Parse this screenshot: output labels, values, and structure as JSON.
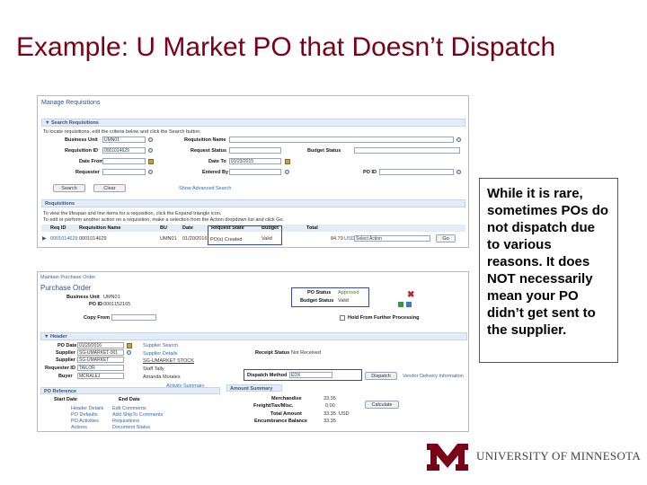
{
  "slide": {
    "title": "Example: U Market PO that Doesn’t Dispatch",
    "callout": "While it is rare, sometimes POs do not dispatch due to various reasons. It does NOT necessarily mean your PO didn’t get sent to the supplier.",
    "footer_org": "UNIVERSITY OF MINNESOTA",
    "colors": {
      "title": "#7a0019",
      "footer_logo": "#7a0019"
    }
  },
  "manage_requisitions": {
    "heading": "Manage Requisitions",
    "search_section": "Search Requisitions",
    "instructions": "To locate requisitions, edit the criteria below and click the Search button.",
    "fields": {
      "business_unit_label": "Business Unit",
      "business_unit_value": "UMN01",
      "requisition_id_label": "Requisition ID",
      "requisition_id_value": "0001014629",
      "date_from_label": "Date From",
      "requester_label": "Requester",
      "requisition_name_label": "Requisition Name",
      "request_status_label": "Request Status",
      "date_to_label": "Date To",
      "date_to_value": "01/23/2015",
      "entered_by_label": "Entered By",
      "budget_status_label": "Budget Status",
      "po_id_label": "PO ID"
    },
    "search_button": "Search",
    "clear_button": "Clear",
    "advanced_link": "Show Advanced Search",
    "results_section": "Requisitions",
    "results_note": "To view the lifespan and line items for a requisition, click the Expand triangle icon.",
    "results_note2": "To edit or perform another action on a requisition, make a selection from the Action dropdown list and click Go.",
    "columns": [
      "Req ID",
      "Requisition Name",
      "BU",
      "Date",
      "Request State",
      "Budget",
      "Total"
    ],
    "row": {
      "req_id": "0001014629",
      "name": "0001014629",
      "bu": "UMN01",
      "date": "01/20/2016",
      "request_state": "PO(s) Created",
      "budget": "Valid",
      "total": "84.79",
      "currency": "USD",
      "action": "Select Action",
      "go": "Go"
    }
  },
  "maintain_po": {
    "breadcrumb": "Maintain Purchase Order",
    "heading": "Purchase Order",
    "business_unit_label": "Business Unit",
    "business_unit_value": "UMN01",
    "po_id_label": "PO ID",
    "po_id_value": "0001152165",
    "po_status_label": "PO Status",
    "po_status_value": "Approved",
    "budget_status_label": "Budget Status",
    "budget_status_value": "Valid",
    "copy_from_label": "Copy From",
    "hold_label": "Hold From Further Processing",
    "header_section": "Header",
    "po_date_label": "PO Date",
    "po_date_value": "01/20/2016",
    "supplier_label": "Supplier",
    "supplier_value": "SG-UMARKET-001",
    "supplier_id_label": "Supplier ID",
    "supplier_id_value": "SG-UMARKET",
    "requester_label": "Requester ID",
    "requester_value": "TAILOR",
    "buyer_label": "Buyer",
    "buyer_value": "MCRALEJ",
    "supplier_search": "Supplier Search",
    "supplier_details": "Supplier Details",
    "supplier_name": "SG-UMARKET STOCK",
    "requester_name": "Staff Tally",
    "buyer_name": "Amanda Morales",
    "receipt_status_label": "Receipt Status",
    "receipt_status_value": "Not Received",
    "dispatch_method_label": "Dispatch Method",
    "dispatch_method_value": "EDX",
    "dispatch_button": "Dispatch",
    "vendor_delivery_link": "Vendor Delivery Information",
    "activity_summary_link": "Activity Summary",
    "po_reference_label": "PO Reference",
    "start_date_label": "Start Date",
    "end_date_label": "End Date",
    "links_col1": [
      "Header Details",
      "PO Defaults",
      "PO Activities",
      "Actions"
    ],
    "links_col2": [
      "Edit Comments",
      "Add ShipTo Comments",
      "Requisitions",
      "Document Status"
    ],
    "amount_tab": "Amount Summary",
    "merchandise_label": "Merchandise",
    "merchandise_value": "33.35",
    "freight_label": "Freight/Tax/Misc.",
    "freight_value": "0.00",
    "total_label": "Total Amount",
    "total_value": "33.35",
    "total_currency": "USD",
    "encumbrance_label": "Encumbrance Balance",
    "encumbrance_value": "33.35",
    "calculate_button": "Calculate"
  }
}
